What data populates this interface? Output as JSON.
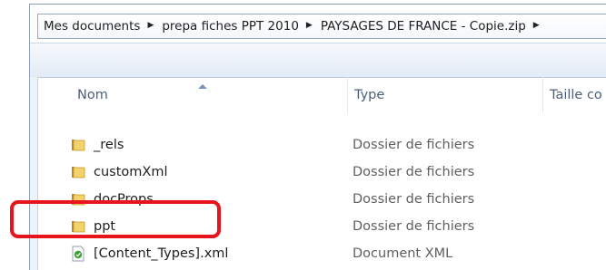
{
  "address_bar": {
    "crumbs": [
      "Mes documents",
      "prepa fiches PPT 2010",
      "PAYSAGES DE FRANCE - Copie.zip"
    ]
  },
  "columns": {
    "name": "Nom",
    "type": "Type",
    "size": "Taille co"
  },
  "rows": [
    {
      "name": "_rels",
      "type": "Dossier de fichiers",
      "icon": "folder-icon"
    },
    {
      "name": "customXml",
      "type": "Dossier de fichiers",
      "icon": "folder-icon"
    },
    {
      "name": "docProps",
      "type": "Dossier de fichiers",
      "icon": "folder-icon"
    },
    {
      "name": "ppt",
      "type": "Dossier de fichiers",
      "icon": "folder-icon"
    },
    {
      "name": "[Content_Types].xml",
      "type": "Document XML",
      "icon": "xml-document-icon"
    }
  ],
  "colors": {
    "highlight": "#e8141b",
    "folder": "#e9c04a"
  }
}
